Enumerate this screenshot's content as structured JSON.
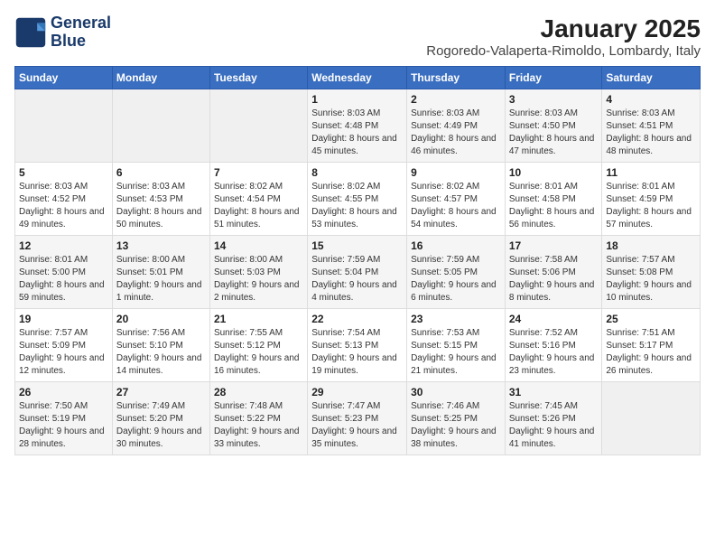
{
  "logo": {
    "line1": "General",
    "line2": "Blue"
  },
  "title": "January 2025",
  "subtitle": "Rogoredo-Valaperta-Rimoldo, Lombardy, Italy",
  "days_of_week": [
    "Sunday",
    "Monday",
    "Tuesday",
    "Wednesday",
    "Thursday",
    "Friday",
    "Saturday"
  ],
  "weeks": [
    [
      {
        "day": "",
        "info": ""
      },
      {
        "day": "",
        "info": ""
      },
      {
        "day": "",
        "info": ""
      },
      {
        "day": "1",
        "info": "Sunrise: 8:03 AM\nSunset: 4:48 PM\nDaylight: 8 hours and 45 minutes."
      },
      {
        "day": "2",
        "info": "Sunrise: 8:03 AM\nSunset: 4:49 PM\nDaylight: 8 hours and 46 minutes."
      },
      {
        "day": "3",
        "info": "Sunrise: 8:03 AM\nSunset: 4:50 PM\nDaylight: 8 hours and 47 minutes."
      },
      {
        "day": "4",
        "info": "Sunrise: 8:03 AM\nSunset: 4:51 PM\nDaylight: 8 hours and 48 minutes."
      }
    ],
    [
      {
        "day": "5",
        "info": "Sunrise: 8:03 AM\nSunset: 4:52 PM\nDaylight: 8 hours and 49 minutes."
      },
      {
        "day": "6",
        "info": "Sunrise: 8:03 AM\nSunset: 4:53 PM\nDaylight: 8 hours and 50 minutes."
      },
      {
        "day": "7",
        "info": "Sunrise: 8:02 AM\nSunset: 4:54 PM\nDaylight: 8 hours and 51 minutes."
      },
      {
        "day": "8",
        "info": "Sunrise: 8:02 AM\nSunset: 4:55 PM\nDaylight: 8 hours and 53 minutes."
      },
      {
        "day": "9",
        "info": "Sunrise: 8:02 AM\nSunset: 4:57 PM\nDaylight: 8 hours and 54 minutes."
      },
      {
        "day": "10",
        "info": "Sunrise: 8:01 AM\nSunset: 4:58 PM\nDaylight: 8 hours and 56 minutes."
      },
      {
        "day": "11",
        "info": "Sunrise: 8:01 AM\nSunset: 4:59 PM\nDaylight: 8 hours and 57 minutes."
      }
    ],
    [
      {
        "day": "12",
        "info": "Sunrise: 8:01 AM\nSunset: 5:00 PM\nDaylight: 8 hours and 59 minutes."
      },
      {
        "day": "13",
        "info": "Sunrise: 8:00 AM\nSunset: 5:01 PM\nDaylight: 9 hours and 1 minute."
      },
      {
        "day": "14",
        "info": "Sunrise: 8:00 AM\nSunset: 5:03 PM\nDaylight: 9 hours and 2 minutes."
      },
      {
        "day": "15",
        "info": "Sunrise: 7:59 AM\nSunset: 5:04 PM\nDaylight: 9 hours and 4 minutes."
      },
      {
        "day": "16",
        "info": "Sunrise: 7:59 AM\nSunset: 5:05 PM\nDaylight: 9 hours and 6 minutes."
      },
      {
        "day": "17",
        "info": "Sunrise: 7:58 AM\nSunset: 5:06 PM\nDaylight: 9 hours and 8 minutes."
      },
      {
        "day": "18",
        "info": "Sunrise: 7:57 AM\nSunset: 5:08 PM\nDaylight: 9 hours and 10 minutes."
      }
    ],
    [
      {
        "day": "19",
        "info": "Sunrise: 7:57 AM\nSunset: 5:09 PM\nDaylight: 9 hours and 12 minutes."
      },
      {
        "day": "20",
        "info": "Sunrise: 7:56 AM\nSunset: 5:10 PM\nDaylight: 9 hours and 14 minutes."
      },
      {
        "day": "21",
        "info": "Sunrise: 7:55 AM\nSunset: 5:12 PM\nDaylight: 9 hours and 16 minutes."
      },
      {
        "day": "22",
        "info": "Sunrise: 7:54 AM\nSunset: 5:13 PM\nDaylight: 9 hours and 19 minutes."
      },
      {
        "day": "23",
        "info": "Sunrise: 7:53 AM\nSunset: 5:15 PM\nDaylight: 9 hours and 21 minutes."
      },
      {
        "day": "24",
        "info": "Sunrise: 7:52 AM\nSunset: 5:16 PM\nDaylight: 9 hours and 23 minutes."
      },
      {
        "day": "25",
        "info": "Sunrise: 7:51 AM\nSunset: 5:17 PM\nDaylight: 9 hours and 26 minutes."
      }
    ],
    [
      {
        "day": "26",
        "info": "Sunrise: 7:50 AM\nSunset: 5:19 PM\nDaylight: 9 hours and 28 minutes."
      },
      {
        "day": "27",
        "info": "Sunrise: 7:49 AM\nSunset: 5:20 PM\nDaylight: 9 hours and 30 minutes."
      },
      {
        "day": "28",
        "info": "Sunrise: 7:48 AM\nSunset: 5:22 PM\nDaylight: 9 hours and 33 minutes."
      },
      {
        "day": "29",
        "info": "Sunrise: 7:47 AM\nSunset: 5:23 PM\nDaylight: 9 hours and 35 minutes."
      },
      {
        "day": "30",
        "info": "Sunrise: 7:46 AM\nSunset: 5:25 PM\nDaylight: 9 hours and 38 minutes."
      },
      {
        "day": "31",
        "info": "Sunrise: 7:45 AM\nSunset: 5:26 PM\nDaylight: 9 hours and 41 minutes."
      },
      {
        "day": "",
        "info": ""
      }
    ]
  ]
}
